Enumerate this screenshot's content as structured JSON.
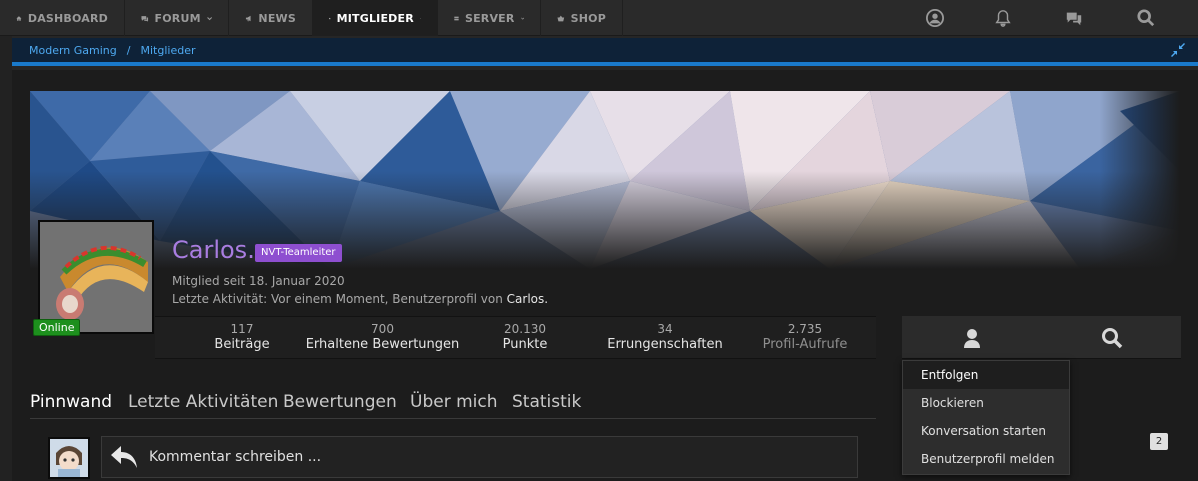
{
  "nav": {
    "items": [
      {
        "label": "Dashboard",
        "icon": "home-icon"
      },
      {
        "label": "Forum",
        "icon": "comments-icon",
        "dropdown": true
      },
      {
        "label": "News",
        "icon": "megaphone-icon"
      },
      {
        "label": "Mitglieder",
        "icon": "users-icon",
        "dropdown": true,
        "active": true
      },
      {
        "label": "Server",
        "icon": "server-icon",
        "dropdown": true
      },
      {
        "label": "Shop",
        "icon": "basket-icon"
      }
    ],
    "right_icons": [
      "user-circle-icon",
      "bell-icon",
      "chat-icon",
      "search-icon"
    ]
  },
  "breadcrumb": {
    "items": [
      "Modern Gaming",
      "Mitglieder"
    ],
    "separator": "/"
  },
  "profile": {
    "username": "Carlos.",
    "rank_badge": "NVT-Teamleiter",
    "status": "Online",
    "member_since": "Mitglied seit 18. Januar 2020",
    "activity_prefix": "Letzte Aktivität: Vor einem Moment,  Benutzerprofil von",
    "activity_user": "Carlos.",
    "stats": [
      {
        "value": "117",
        "label": "Beiträge"
      },
      {
        "value": "700",
        "label": "Erhaltene Bewertungen"
      },
      {
        "value": "20.130",
        "label": "Punkte"
      },
      {
        "value": "34",
        "label": "Errungenschaften"
      },
      {
        "value": "2.735",
        "label": "Profil-Aufrufe"
      }
    ]
  },
  "dropdown": {
    "items": [
      "Entfolgen",
      "Blockieren",
      "Konversation starten",
      "Benutzerprofil melden"
    ]
  },
  "side_count": "2",
  "tabs": [
    "Pinnwand",
    "Letzte Aktivitäten",
    "Bewertungen",
    "Über mich",
    "Statistik"
  ],
  "comment": {
    "placeholder": "Kommentar schreiben ..."
  },
  "colors": {
    "username": "#a97de0",
    "badge": "#8e4fd0",
    "online": "#1d8f1d",
    "breadcrumb_bar": "#0e2238",
    "breadcrumb_accent": "#1a7acb"
  }
}
